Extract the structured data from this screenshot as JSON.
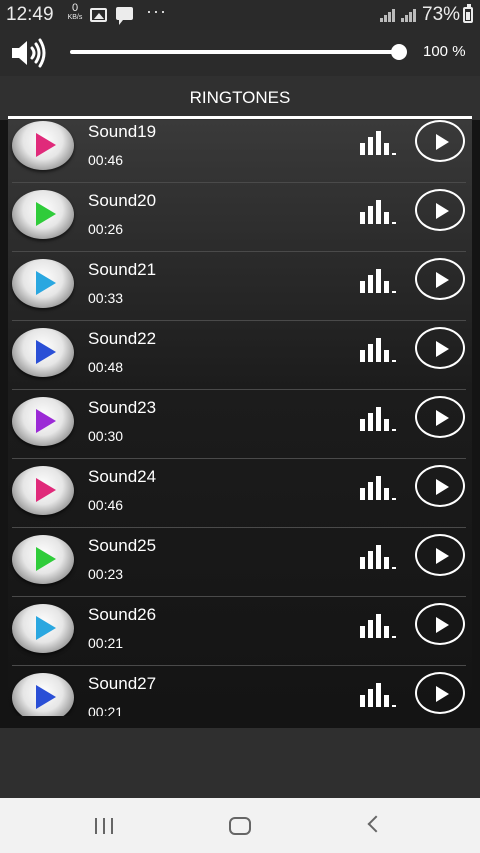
{
  "status_bar": {
    "time": "12:49",
    "net_speed_value": "0",
    "net_speed_unit": "KB/s",
    "more_indicator": "···",
    "battery": "73%"
  },
  "volume": {
    "level_percent": 100,
    "label": "100 %"
  },
  "header": {
    "title": "RINGTONES"
  },
  "ringtones": [
    {
      "name": "Sound19",
      "duration": "00:46",
      "color": "#e02a7a"
    },
    {
      "name": "Sound20",
      "duration": "00:26",
      "color": "#2fcc3a"
    },
    {
      "name": "Sound21",
      "duration": "00:33",
      "color": "#2aa7e0"
    },
    {
      "name": "Sound22",
      "duration": "00:48",
      "color": "#2a4fd6"
    },
    {
      "name": "Sound23",
      "duration": "00:30",
      "color": "#9b2ad6"
    },
    {
      "name": "Sound24",
      "duration": "00:46",
      "color": "#e02a7a"
    },
    {
      "name": "Sound25",
      "duration": "00:23",
      "color": "#2fcc3a"
    },
    {
      "name": "Sound26",
      "duration": "00:21",
      "color": "#2aa7e0"
    },
    {
      "name": "Sound27",
      "duration": "00:21",
      "color": "#2a4fd6"
    }
  ],
  "icons": {
    "row_disc": "play-disc-icon",
    "row_equalizer": "equalizer-icon",
    "row_play": "play-circle-icon",
    "volume": "speaker-icon",
    "nav_recents": "recents-icon",
    "nav_home": "home-icon",
    "nav_back": "back-icon"
  }
}
